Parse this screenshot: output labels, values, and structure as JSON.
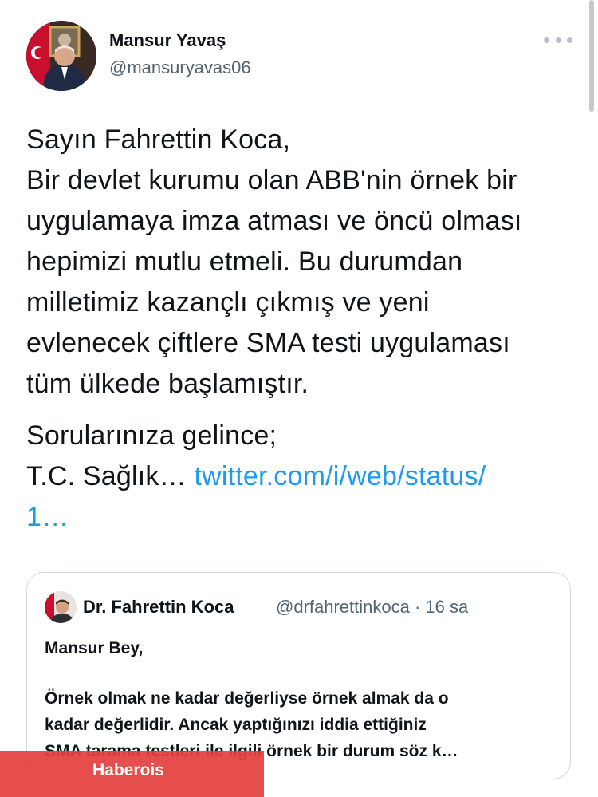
{
  "author": {
    "name": "Mansur Yavaş",
    "handle": "@mansuryavas06",
    "avatar_icon": "profile-photo"
  },
  "more_icon": "more-horizontal-icon",
  "tweet": {
    "lines": [
      "Sayın Fahrettin Koca,",
      "Bir devlet kurumu olan ABB'nin örnek bir",
      "uygulamaya imza atması ve öncü olması",
      "hepimizi mutlu etmeli. Bu durumdan",
      "milletimiz kazançlı çıkmış ve yeni",
      "evlenecek çiftlere SMA testi uygulaması",
      "tüm ülkede başlamıştır."
    ],
    "line_after_gap": "Sorularınıza gelince;",
    "prefix": "T.C. Sağlık…",
    "link_part1": "twitter.com/i/web/status/",
    "link_part2": "1…",
    "link_color": "#1d9bf0"
  },
  "quoted": {
    "name": "Dr. Fahrettin Koca",
    "meta": "@drfahrettinkoca · 16 sa",
    "greeting": "Mansur Bey,",
    "lines": [
      "Örnek olmak ne kadar değerliyse örnek almak da o",
      "kadar değerlidir. Ancak yaptığınızı iddia ettiğiniz",
      "SMA tarama testleri ile ilgili örnek bir durum söz k…"
    ]
  },
  "watermark": {
    "label": "Haberois",
    "color": "#e43f3f"
  }
}
